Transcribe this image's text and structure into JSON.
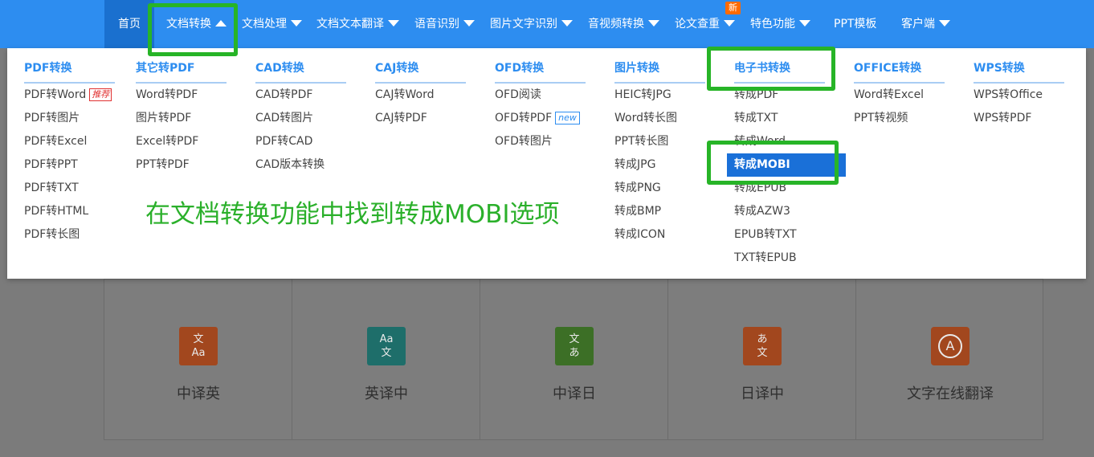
{
  "nav": {
    "items": [
      {
        "label": "首页"
      },
      {
        "label": "文档转换"
      },
      {
        "label": "文档处理"
      },
      {
        "label": "文档文本翻译"
      },
      {
        "label": "语音识别"
      },
      {
        "label": "图片文字识别"
      },
      {
        "label": "音视频转换"
      },
      {
        "label": "论文查重"
      },
      {
        "label": "特色功能"
      },
      {
        "label": "PPT模板"
      },
      {
        "label": "客户端"
      }
    ],
    "badge": "新"
  },
  "menu": {
    "columns": [
      {
        "title": "PDF转换",
        "items": [
          "PDF转Word",
          "PDF转图片",
          "PDF转Excel",
          "PDF转PPT",
          "PDF转TXT",
          "PDF转HTML",
          "PDF转长图"
        ],
        "tag": "推荐"
      },
      {
        "title": "其它转PDF",
        "items": [
          "Word转PDF",
          "图片转PDF",
          "Excel转PDF",
          "PPT转PDF"
        ]
      },
      {
        "title": "CAD转换",
        "items": [
          "CAD转PDF",
          "CAD转图片",
          "PDF转CAD",
          "CAD版本转换"
        ]
      },
      {
        "title": "CAJ转换",
        "items": [
          "CAJ转Word",
          "CAJ转PDF"
        ]
      },
      {
        "title": "OFD转换",
        "items": [
          "OFD阅读",
          "OFD转PDF",
          "OFD转图片"
        ],
        "tag": "new"
      },
      {
        "title": "图片转换",
        "items": [
          "HEIC转JPG",
          "Word转长图",
          "PPT转长图",
          "转成JPG",
          "转成PNG",
          "转成BMP",
          "转成ICON"
        ]
      },
      {
        "title": "电子书转换",
        "items": [
          "转成PDF",
          "转成TXT",
          "转成Word",
          "转成MOBI",
          "转成EPUB",
          "转成AZW3",
          "EPUB转TXT",
          "TXT转EPUB"
        ]
      },
      {
        "title": "OFFICE转换",
        "items": [
          "Word转Excel",
          "PPT转视频"
        ]
      },
      {
        "title": "WPS转换",
        "items": [
          "WPS转Office",
          "WPS转PDF"
        ]
      }
    ]
  },
  "caption": "在文档转换功能中找到转成MOBI选项",
  "cards": [
    {
      "label": "中译英",
      "icon_top": "文",
      "icon_bottom": "Aa",
      "color": "#a2471e"
    },
    {
      "label": "英译中",
      "icon_top": "Aa",
      "icon_bottom": "文",
      "color": "#1e6e6a"
    },
    {
      "label": "中译日",
      "icon_top": "文",
      "icon_bottom": "あ",
      "color": "#3c6f26"
    },
    {
      "label": "日译中",
      "icon_top": "あ",
      "icon_bottom": "文",
      "color": "#a2471e"
    },
    {
      "label": "文字在线翻译",
      "icon_top": "A",
      "icon_bottom": "",
      "color": "#a2471e"
    }
  ],
  "colors": {
    "nav_bg": "#2d8df0",
    "nav_active": "#1a70cf",
    "highlight": "#27b427",
    "active_item": "#1a70d8",
    "caption": "#2bb02b"
  }
}
